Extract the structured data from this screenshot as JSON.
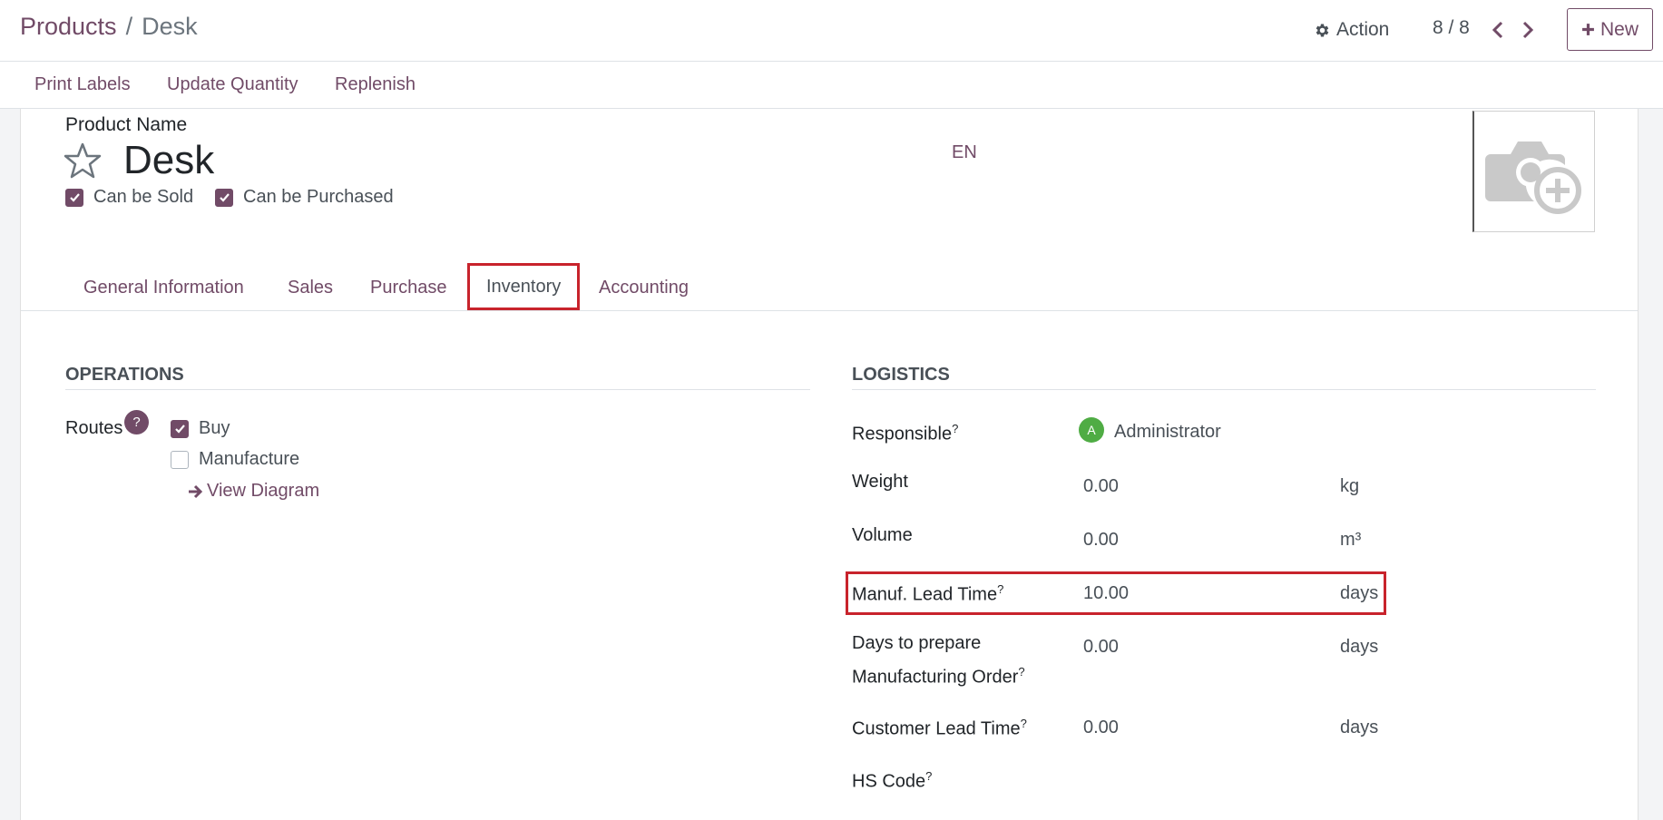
{
  "breadcrumb": {
    "parent": "Products",
    "separator": "/",
    "current": "Desk"
  },
  "controls": {
    "action_label": "Action",
    "pager": "8 / 8",
    "new_label": "New"
  },
  "status_buttons": [
    "Print Labels",
    "Update Quantity",
    "Replenish"
  ],
  "form": {
    "product_name_label": "Product Name",
    "product_name": "Desk",
    "lang": "EN",
    "can_be_sold": "Can be Sold",
    "can_be_purchased": "Can be Purchased"
  },
  "tabs": [
    "General Information",
    "Sales",
    "Purchase",
    "Inventory",
    "Accounting"
  ],
  "active_tab": "Inventory",
  "operations": {
    "title": "OPERATIONS",
    "routes_label": "Routes",
    "routes_help": "?",
    "routes": [
      {
        "label": "Buy",
        "checked": true
      },
      {
        "label": "Manufacture",
        "checked": false
      }
    ],
    "view_diagram": "View Diagram"
  },
  "logistics": {
    "title": "LOGISTICS",
    "responsible_label": "Responsible",
    "responsible_value": "Administrator",
    "responsible_initial": "A",
    "weight_label": "Weight",
    "weight_value": "0.00",
    "weight_unit": "kg",
    "volume_label": "Volume",
    "volume_value": "0.00",
    "volume_unit": "m³",
    "manuf_lead_label": "Manuf. Lead Time",
    "manuf_lead_value": "10.00",
    "manuf_lead_unit": "days",
    "days_prepare_label_1": "Days to prepare",
    "days_prepare_label_2": "Manufacturing Order",
    "days_prepare_value": "0.00",
    "days_prepare_unit": "days",
    "customer_lead_label": "Customer Lead Time",
    "customer_lead_value": "0.00",
    "customer_lead_unit": "days",
    "hs_code_label": "HS Code",
    "help_mark": "?"
  },
  "colors": {
    "accent": "#714b67",
    "highlight": "#c8232c",
    "avatar": "#4fac44"
  }
}
